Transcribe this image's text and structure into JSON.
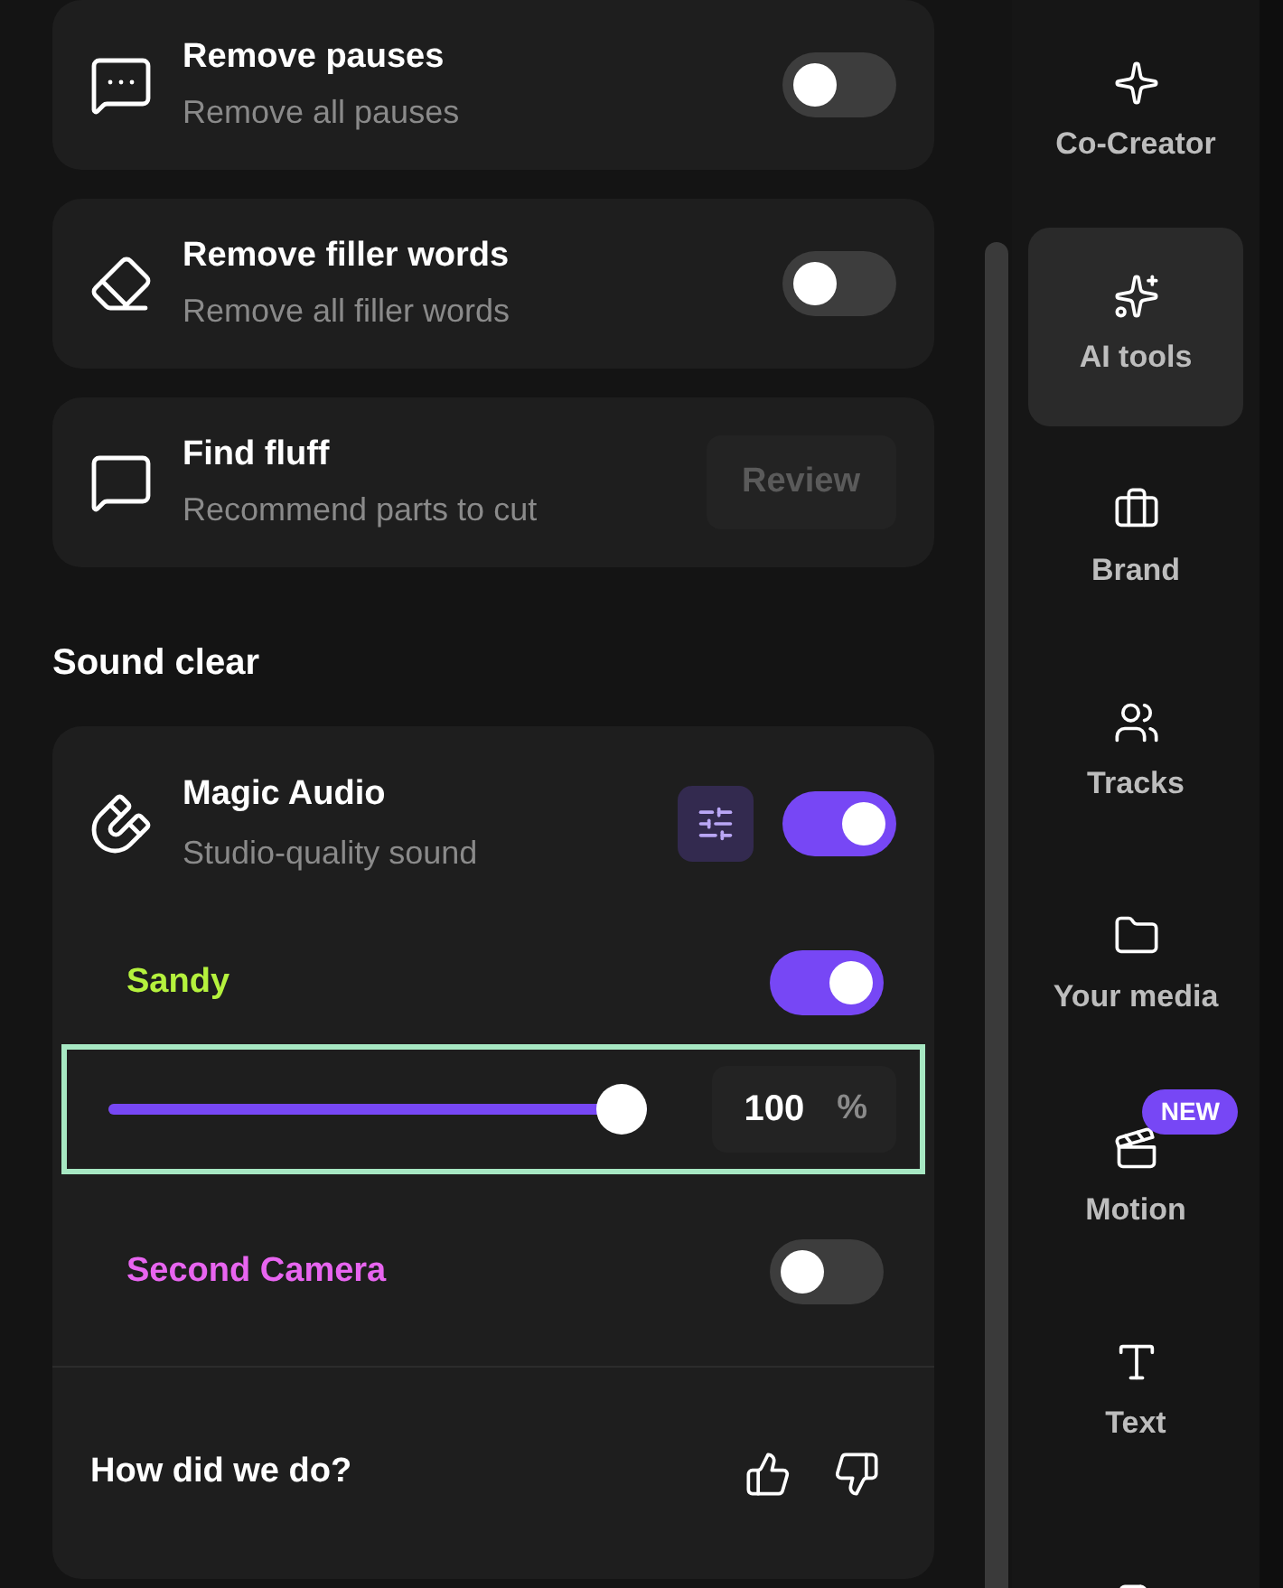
{
  "tools": [
    {
      "title": "Remove pauses",
      "subtitle": "Remove all pauses",
      "control": {
        "kind": "toggle",
        "on": false
      }
    },
    {
      "title": "Remove filler words",
      "subtitle": "Remove all filler words",
      "control": {
        "kind": "toggle",
        "on": false
      }
    },
    {
      "title": "Find fluff",
      "subtitle": "Recommend parts to cut",
      "control": {
        "kind": "button",
        "label": "Review",
        "disabled": true
      }
    }
  ],
  "sound_clear": {
    "heading": "Sound clear",
    "magic_audio": {
      "title": "Magic Audio",
      "subtitle": "Studio-quality sound",
      "on": true
    },
    "tracks": [
      {
        "name": "Sandy",
        "color": "#b5f23d",
        "on": true,
        "slider": {
          "level": 1,
          "value": "100",
          "unit": "%",
          "focused": true
        }
      },
      {
        "name": "Second Camera",
        "color": "#e865f0",
        "on": false
      }
    ],
    "feedback": {
      "question": "How did we do?"
    }
  },
  "sidebar": {
    "items": [
      {
        "label": "Co-Creator",
        "selected": false
      },
      {
        "label": "AI tools",
        "selected": true
      },
      {
        "label": "Brand",
        "selected": false
      },
      {
        "label": "Tracks",
        "selected": false
      },
      {
        "label": "Your media",
        "selected": false
      },
      {
        "label": "Motion",
        "selected": false,
        "badge": "NEW"
      },
      {
        "label": "Text",
        "selected": false
      },
      {
        "selected": false
      }
    ]
  }
}
